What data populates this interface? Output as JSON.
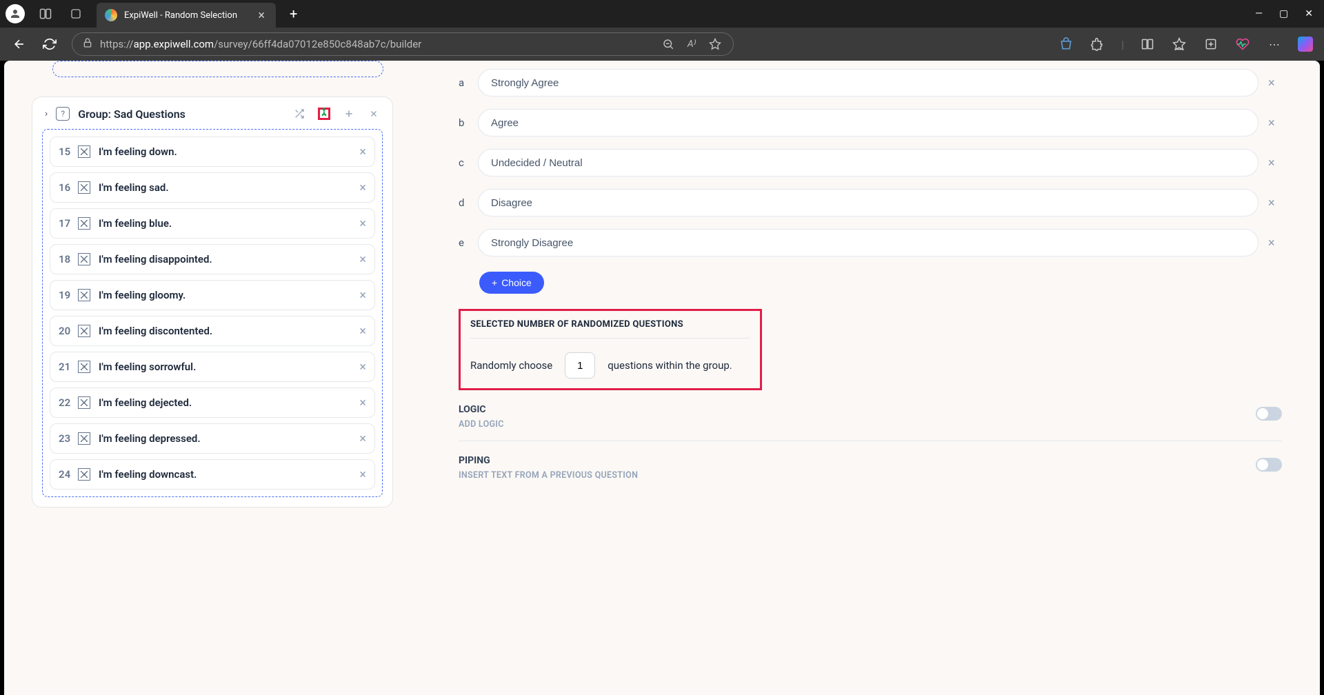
{
  "browser": {
    "tab_title": "ExpiWell - Random Selection",
    "url_prefix": "https://",
    "url_domain": "app.expiwell.com",
    "url_path": "/survey/66ff4da07012e850c848ab7c/builder"
  },
  "group": {
    "title": "Group: Sad Questions",
    "questions": [
      {
        "num": "15",
        "text": "I'm feeling down."
      },
      {
        "num": "16",
        "text": "I'm feeling sad."
      },
      {
        "num": "17",
        "text": "I'm feeling blue."
      },
      {
        "num": "18",
        "text": "I'm feeling disappointed."
      },
      {
        "num": "19",
        "text": "I'm feeling gloomy."
      },
      {
        "num": "20",
        "text": "I'm feeling discontented."
      },
      {
        "num": "21",
        "text": "I'm feeling sorrowful."
      },
      {
        "num": "22",
        "text": "I'm feeling dejected."
      },
      {
        "num": "23",
        "text": "I'm feeling depressed."
      },
      {
        "num": "24",
        "text": "I'm feeling downcast."
      }
    ]
  },
  "choices": [
    {
      "letter": "a",
      "text": "Strongly Agree"
    },
    {
      "letter": "b",
      "text": "Agree"
    },
    {
      "letter": "c",
      "text": "Undecided / Neutral"
    },
    {
      "letter": "d",
      "text": "Disagree"
    },
    {
      "letter": "e",
      "text": "Strongly Disagree"
    }
  ],
  "add_choice_label": "Choice",
  "random_section": {
    "title": "SELECTED NUMBER OF RANDOMIZED QUESTIONS",
    "prefix": "Randomly choose",
    "value": "1",
    "suffix": "questions within the group."
  },
  "logic": {
    "label": "LOGIC",
    "sub": "ADD LOGIC"
  },
  "piping": {
    "label": "PIPING",
    "sub": "INSERT TEXT FROM A PREVIOUS QUESTION"
  }
}
